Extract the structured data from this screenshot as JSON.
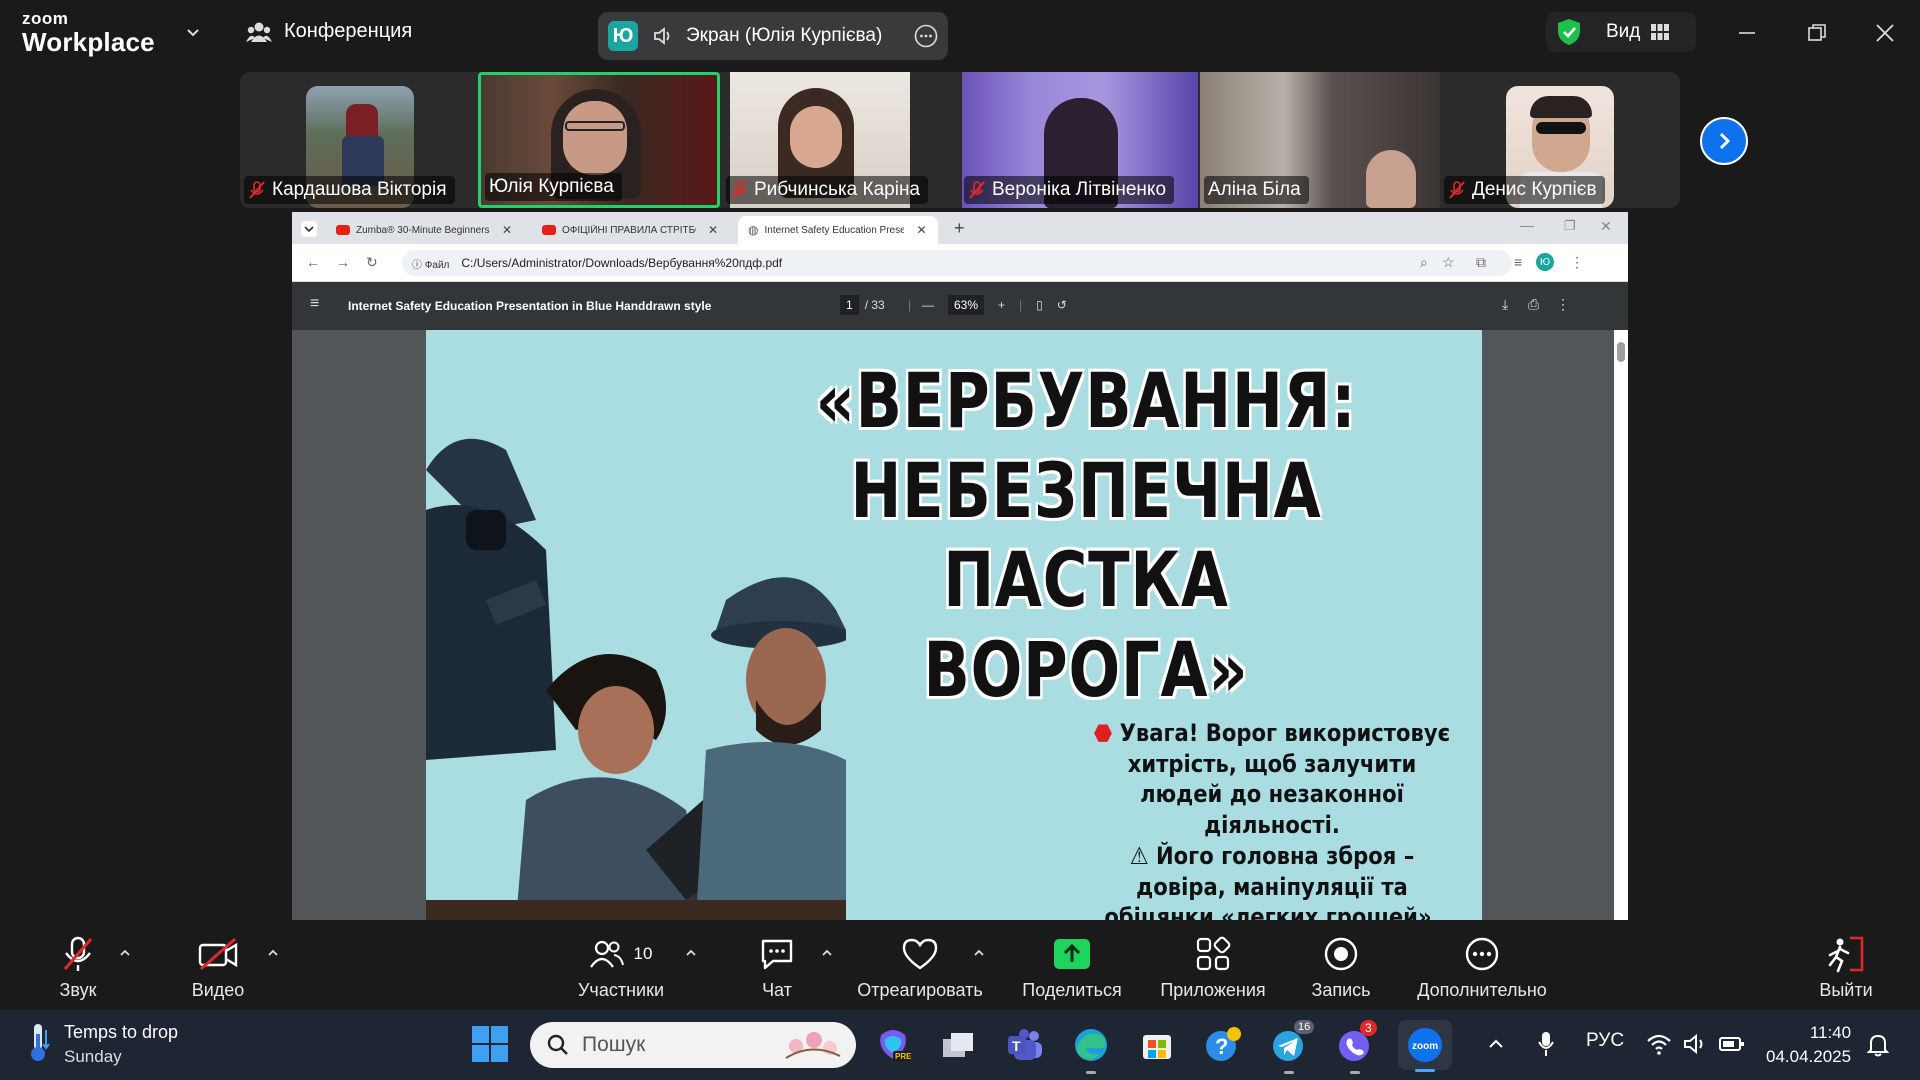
{
  "zoom": {
    "logo_small": "zoom",
    "logo_big": "Workplace",
    "conference_label": "Конференция",
    "share": {
      "avatar_letter": "Ю",
      "text": "Экран (Юлія Курпієва)"
    },
    "view_label": "Вид"
  },
  "participants": [
    {
      "name": "Кардашова Вікторія",
      "muted": true
    },
    {
      "name": "Юлія Курпієва",
      "muted": false,
      "active_speaker": true
    },
    {
      "name": "Рибчинська Каріна",
      "muted": true
    },
    {
      "name": "Вероніка Літвіненко",
      "muted": true
    },
    {
      "name": "Аліна Біла",
      "muted": false
    },
    {
      "name": "Денис Курпієв",
      "muted": true
    }
  ],
  "browser": {
    "tabs": [
      {
        "title": "Zumba® 30-Minute Beginners"
      },
      {
        "title": "ОФІЦІЙНІ ПРАВИЛА СТРІТБОЛУ"
      },
      {
        "title": "Internet Safety Education Prese"
      }
    ],
    "file_label": "Файл",
    "url": "C:/Users/Administrator/Downloads/Вербування%20пдф.pdf",
    "profile_letter": "Ю"
  },
  "pdf": {
    "title": "Internet Safety Education Presentation in Blue Handdrawn style",
    "page_current": "1",
    "page_total": "/ 33",
    "zoom": "63%"
  },
  "slide": {
    "title_lines": [
      "«ВЕРБУВАННЯ:",
      "НЕБЕЗПЕЧНА ПАСТКА",
      "ВОРОГА»"
    ],
    "text_1": "Увага! Ворог використовує хитрість, щоб залучити людей до незаконної діяльності.",
    "text_2": "Його головна зброя – довіра, маніпуляції та обіцянки «легких грошей»."
  },
  "toolbar": {
    "audio": "Звук",
    "video": "Видео",
    "participants": "Участники",
    "participants_count": "10",
    "chat": "Чат",
    "react": "Отреагировать",
    "share": "Поделиться",
    "apps": "Приложения",
    "record": "Запись",
    "more": "Дополнительно",
    "leave": "Выйти"
  },
  "taskbar": {
    "weather_title": "Temps to drop",
    "weather_sub": "Sunday",
    "search_placeholder": "Пошук",
    "telegram_badge": "16",
    "viber_badge": "3",
    "language": "РУС",
    "time": "11:40",
    "date": "04.04.2025"
  },
  "colors": {
    "zoom_blue": "#0e72ed",
    "share_green": "#00c853",
    "slide_bg": "#a9dde2",
    "active_speaker_border": "#22d16b",
    "muted_red": "#e02828"
  }
}
